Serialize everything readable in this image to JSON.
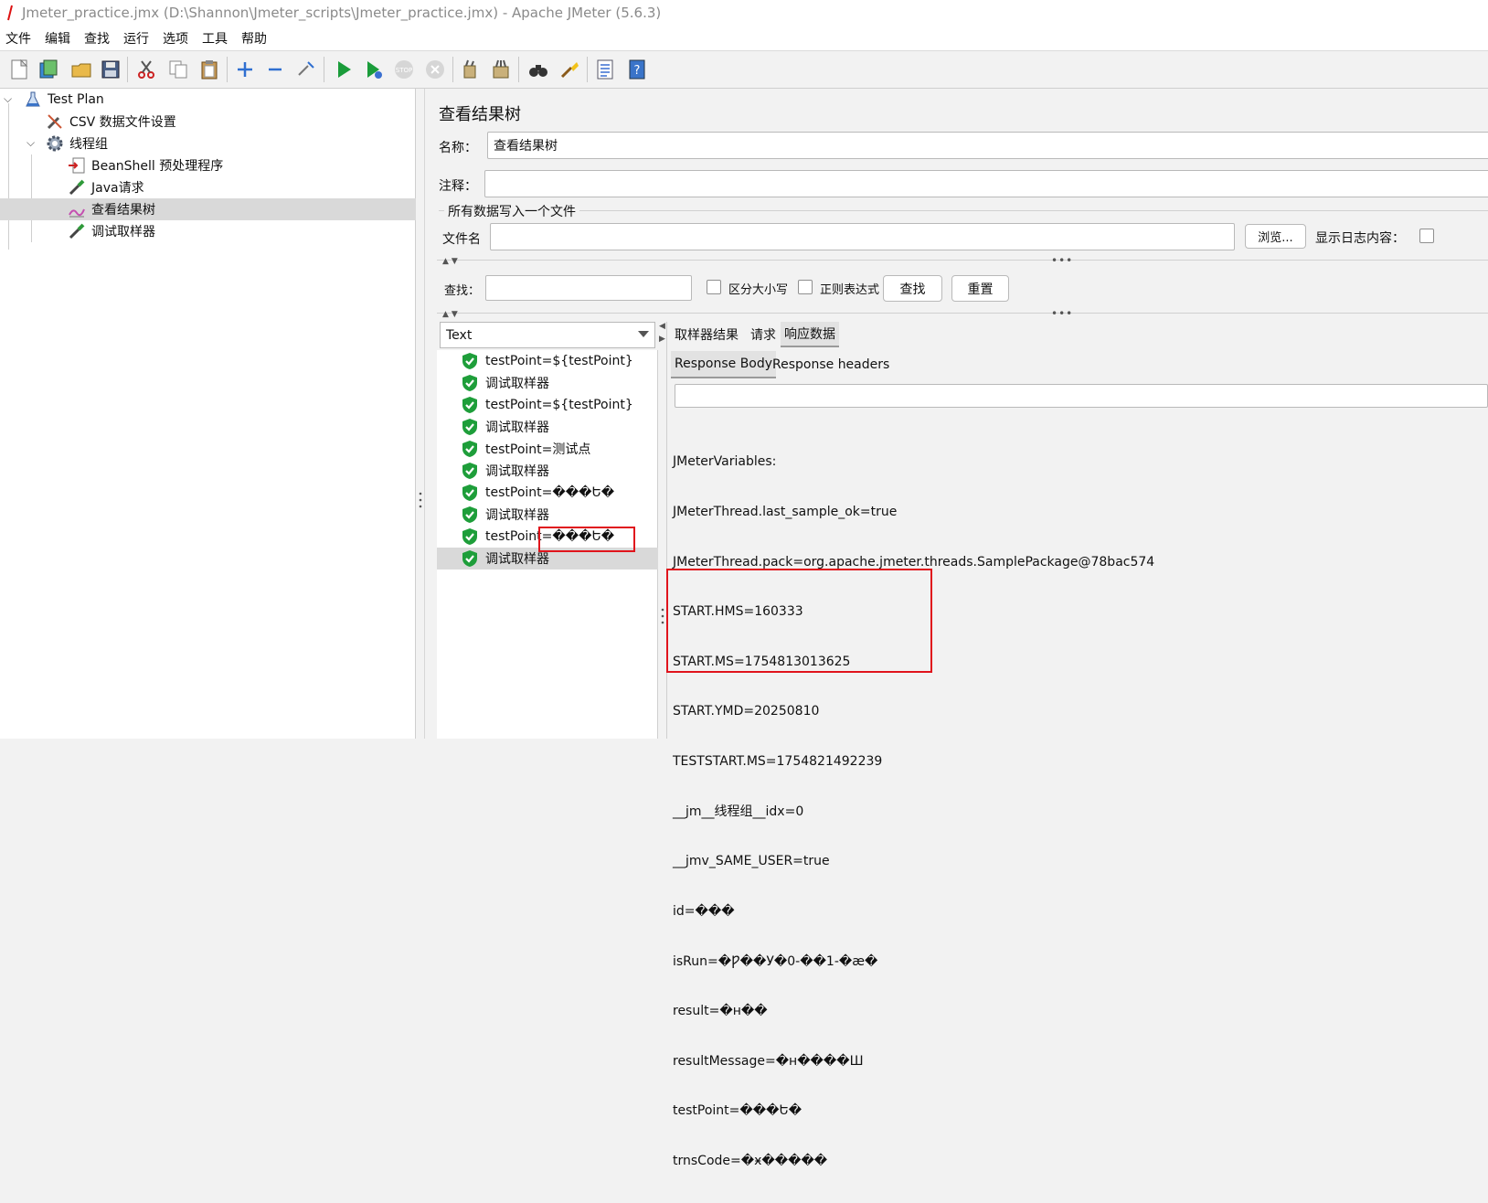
{
  "window": {
    "title": "Jmeter_practice.jmx (D:\\Shannon\\Jmeter_scripts\\Jmeter_practice.jmx) - Apache JMeter (5.6.3)"
  },
  "menu": [
    "文件",
    "编辑",
    "查找",
    "运行",
    "选项",
    "工具",
    "帮助"
  ],
  "toolbar_icons": [
    "new-icon",
    "templates-icon",
    "open-icon",
    "save-icon",
    "cut-icon",
    "copy-icon",
    "paste-icon",
    "expand-icon",
    "collapse-icon",
    "toggle-icon",
    "start-icon",
    "start-no-pause-icon",
    "stop-icon",
    "shutdown-icon",
    "clear-icon",
    "clear-all-icon",
    "search-icon",
    "reset-search-icon",
    "function-helper-icon",
    "help-icon"
  ],
  "tree": {
    "items": [
      {
        "label": "Test Plan",
        "icon": "flask-icon"
      },
      {
        "label": "CSV 数据文件设置",
        "icon": "wrench-icon"
      },
      {
        "label": "线程组",
        "icon": "gear-icon"
      },
      {
        "label": "BeanShell 预处理程序",
        "icon": "preprocessor-icon"
      },
      {
        "label": "Java请求",
        "icon": "pipette-icon"
      },
      {
        "label": "查看结果树",
        "icon": "listener-icon"
      },
      {
        "label": "调试取样器",
        "icon": "pipette-icon"
      }
    ],
    "selected_index": 5
  },
  "panel": {
    "title": "查看结果树",
    "name_label": "名称：",
    "name_value": "查看结果树",
    "comment_label": "注释：",
    "comment_value": "",
    "file_section_label": "所有数据写入一个文件",
    "filename_label": "文件名",
    "filename_value": "",
    "browse_button": "浏览...",
    "log_content_label": "显示日志内容：",
    "search_label": "查找：",
    "search_value": "",
    "case_sensitive_label": "区分大小写",
    "regex_label": "正则表达式",
    "find_button": "查找",
    "reset_button": "重置"
  },
  "results": {
    "renderer": "Text",
    "items": [
      "testPoint=${testPoint}",
      "调试取样器",
      "testPoint=${testPoint}",
      "调试取样器",
      "testPoint=测试点",
      "调试取样器",
      "testPoint=���Ե�",
      "调试取样器",
      "testPoint=���Ե�",
      "调试取样器"
    ],
    "selected_index": 9
  },
  "detail": {
    "tabs": [
      "取样器结果",
      "请求",
      "响应数据"
    ],
    "active_tab": "响应数据",
    "subtabs": [
      "Response Body",
      "Response headers"
    ],
    "active_subtab": "Response Body",
    "body_lines": [
      "JMeterVariables:",
      "JMeterThread.last_sample_ok=true",
      "JMeterThread.pack=org.apache.jmeter.threads.SamplePackage@78bac574",
      "START.HMS=160333",
      "START.MS=1754813013625",
      "START.YMD=20250810",
      "TESTSTART.MS=1754821492239",
      "__jm__线程组__idx=0",
      "__jmv_SAME_USER=true",
      "id=���",
      "isRun=�Ƿ��У�0-��1-�æ�",
      "result=�н��",
      "resultMessage=�н����Ш",
      "testPoint=���Ե�",
      "trnsCode=�ӿ�����"
    ]
  },
  "colors": {
    "highlight_box": "#e0141c",
    "selection": "#d9d9d9",
    "success_shield": "#1e9e3a"
  }
}
